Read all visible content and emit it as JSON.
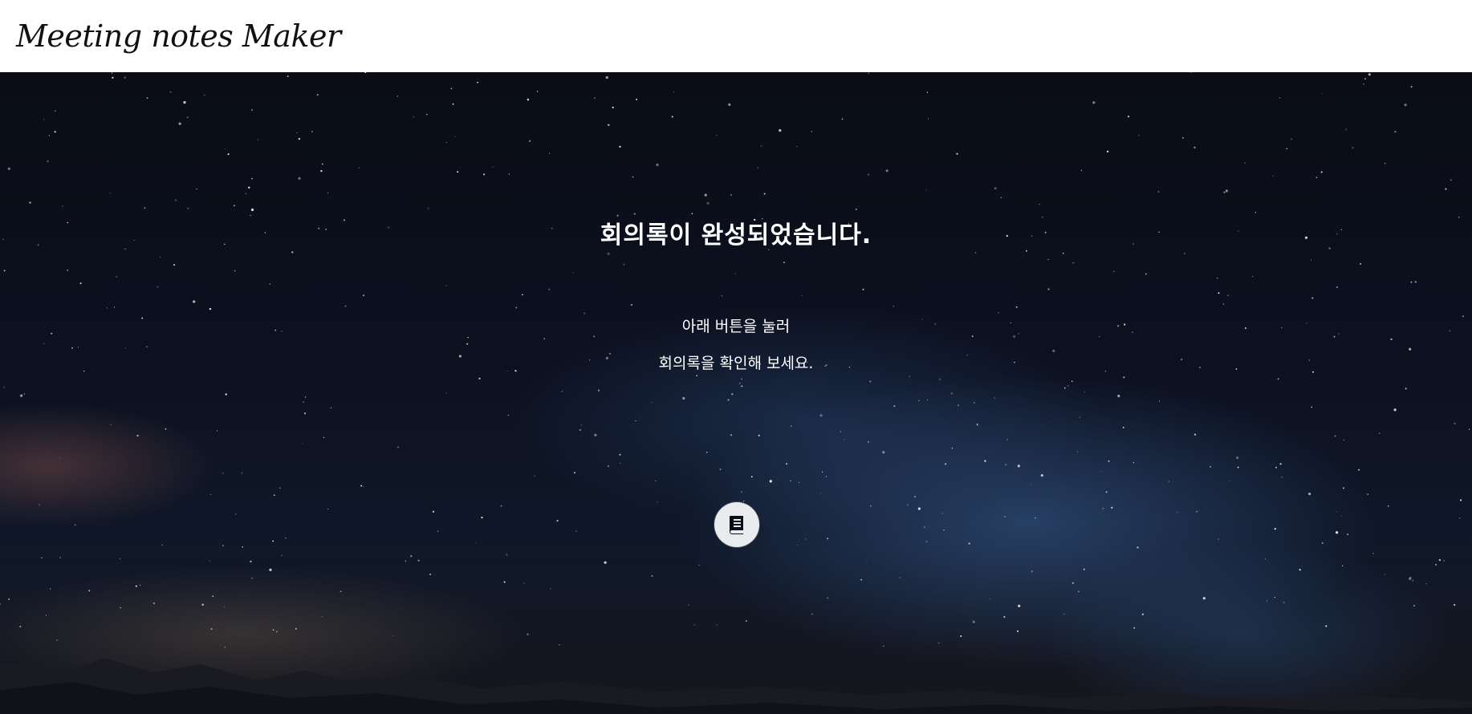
{
  "header": {
    "brand": "Meeting notes Maker"
  },
  "main": {
    "title": "회의록이 완성되었습니다.",
    "instruction_line1": "아래 버튼을 눌러",
    "instruction_line2": "회의록을 확인해 보세요."
  },
  "action": {
    "icon": "book-icon"
  },
  "colors": {
    "header_bg": "#ffffff",
    "text": "#ffffff",
    "button_bg": "#e9ebef",
    "icon": "#0b0f1a"
  }
}
